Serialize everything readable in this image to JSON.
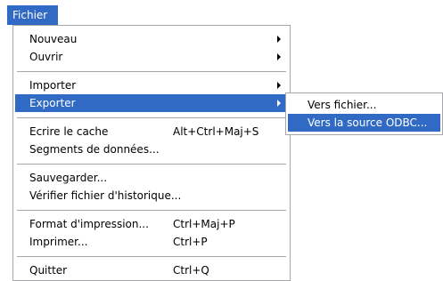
{
  "menubar": {
    "title": "Fichier"
  },
  "menu": {
    "nouveau": "Nouveau",
    "ouvrir": "Ouvrir",
    "importer": "Importer",
    "exporter": "Exporter",
    "ecrire_cache": "Ecrire le cache",
    "ecrire_cache_shortcut": "Alt+Ctrl+Maj+S",
    "segments": "Segments de données...",
    "sauvegarder": "Sauvegarder...",
    "verifier": "Vérifier fichier d'historique...",
    "format_impression": "Format d'impression...",
    "format_impression_shortcut": "Ctrl+Maj+P",
    "imprimer": "Imprimer...",
    "imprimer_shortcut": "Ctrl+P",
    "quitter": "Quitter",
    "quitter_shortcut": "Ctrl+Q"
  },
  "submenu": {
    "vers_fichier": "Vers fichier...",
    "vers_odbc": "Vers la source ODBC..."
  },
  "colors": {
    "highlight": "#316ac5",
    "border": "#a7a6aa"
  }
}
